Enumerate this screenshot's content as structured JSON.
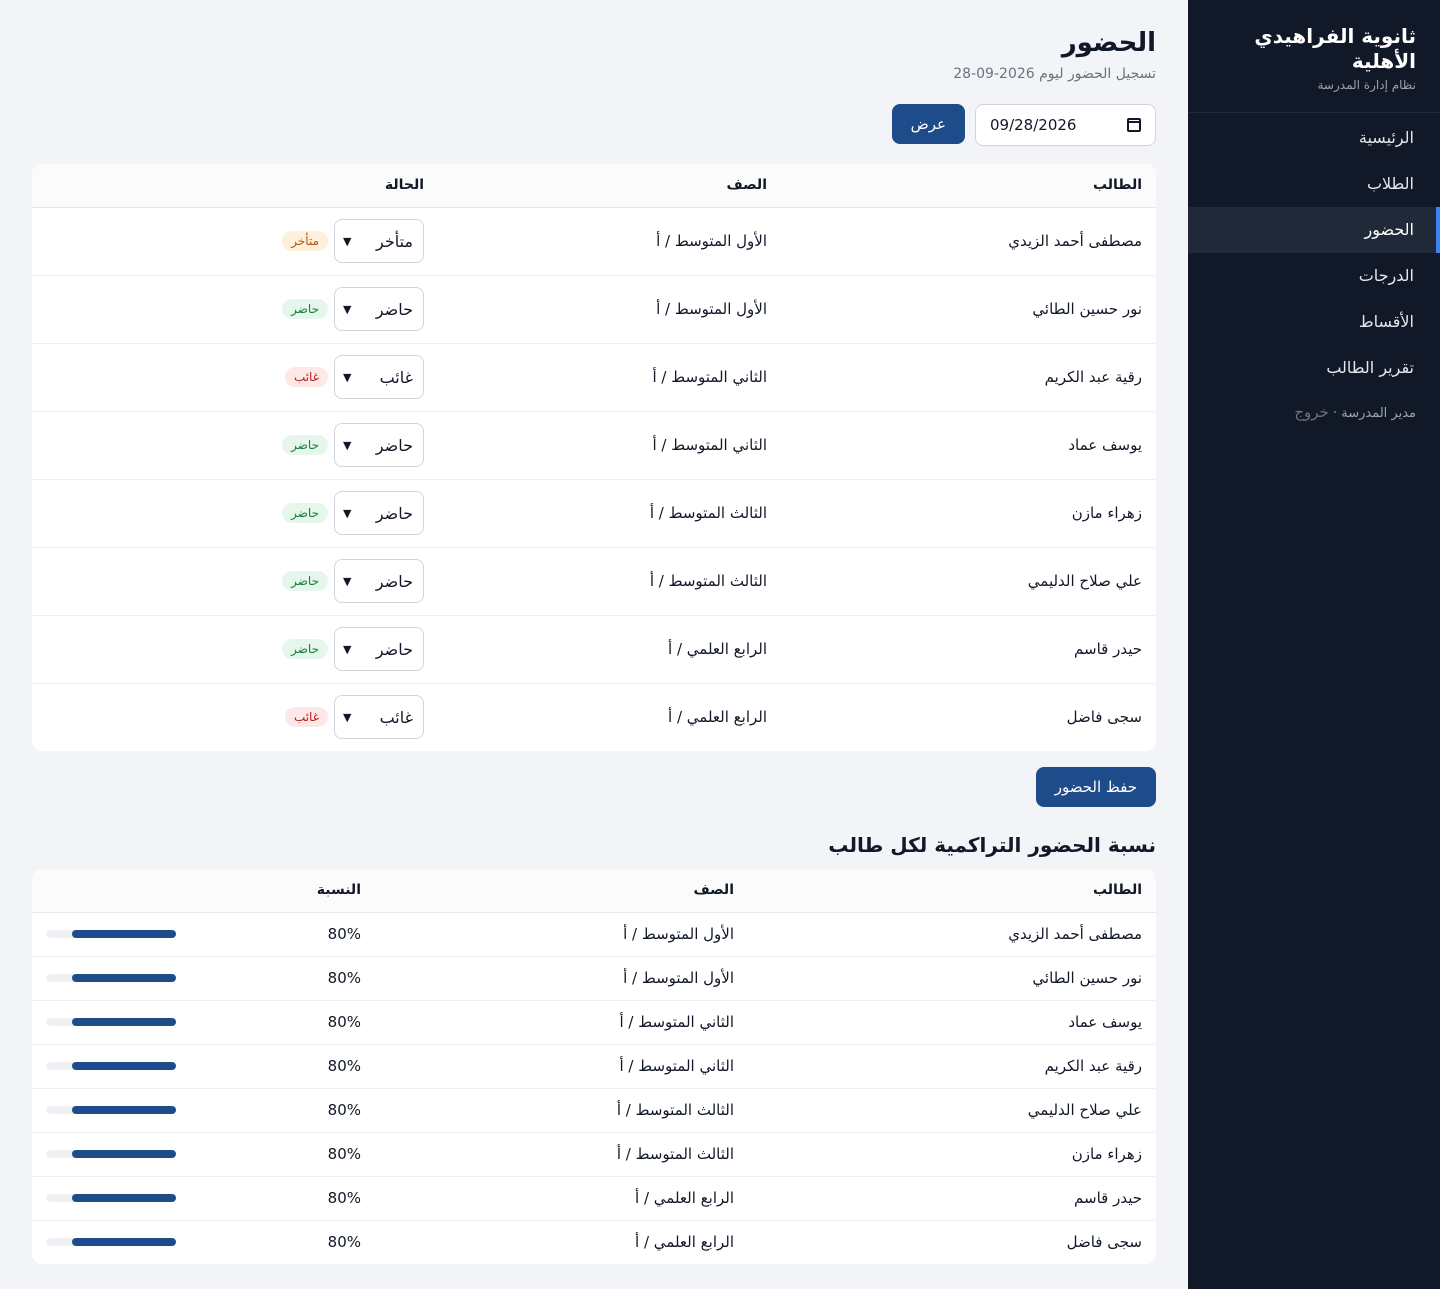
{
  "sidebar": {
    "title": "ثانوية الفراهيدي الأهلية",
    "subtitle": "نظام إدارة المدرسة",
    "items": [
      {
        "label": "الرئيسية",
        "active": false
      },
      {
        "label": "الطلاب",
        "active": false
      },
      {
        "label": "الحضور",
        "active": true
      },
      {
        "label": "الدرجات",
        "active": false
      },
      {
        "label": "الأقساط",
        "active": false
      },
      {
        "label": "تقرير الطالب",
        "active": false
      }
    ],
    "user": "مدير المدرسة",
    "separator": "·",
    "logout": "خروج"
  },
  "header": {
    "title": "الحضور",
    "subtitle": "تسجيل الحضور ليوم 2026-09-28"
  },
  "filters": {
    "date_value": "09/28/2026",
    "show_label": "عرض"
  },
  "attendance": {
    "columns": [
      "الطالب",
      "الصف",
      "الحالة"
    ],
    "rows": [
      {
        "student": "مصطفى أحمد الزيدي",
        "class": "الأول المتوسط / أ",
        "status": "متأخر",
        "badge": "متأخر",
        "kind": "late"
      },
      {
        "student": "نور حسين الطائي",
        "class": "الأول المتوسط / أ",
        "status": "حاضر",
        "badge": "حاضر",
        "kind": "present"
      },
      {
        "student": "رقية عبد الكريم",
        "class": "الثاني المتوسط / أ",
        "status": "غائب",
        "badge": "غائب",
        "kind": "absent"
      },
      {
        "student": "يوسف عماد",
        "class": "الثاني المتوسط / أ",
        "status": "حاضر",
        "badge": "حاضر",
        "kind": "present"
      },
      {
        "student": "زهراء مازن",
        "class": "الثالث المتوسط / أ",
        "status": "حاضر",
        "badge": "حاضر",
        "kind": "present"
      },
      {
        "student": "علي صلاح الدليمي",
        "class": "الثالث المتوسط / أ",
        "status": "حاضر",
        "badge": "حاضر",
        "kind": "present"
      },
      {
        "student": "حيدر قاسم",
        "class": "الرابع العلمي / أ",
        "status": "حاضر",
        "badge": "حاضر",
        "kind": "present"
      },
      {
        "student": "سجى فاضل",
        "class": "الرابع العلمي / أ",
        "status": "غائب",
        "badge": "غائب",
        "kind": "absent"
      }
    ],
    "save_label": "حفظ الحضور"
  },
  "cumulative": {
    "title": "نسبة الحضور التراكمية لكل طالب",
    "columns": [
      "الطالب",
      "الصف",
      "النسبة"
    ],
    "rows": [
      {
        "student": "مصطفى أحمد الزيدي",
        "class": "الأول المتوسط / أ",
        "percent_label": "80%",
        "percent": 80
      },
      {
        "student": "نور حسين الطائي",
        "class": "الأول المتوسط / أ",
        "percent_label": "80%",
        "percent": 80
      },
      {
        "student": "يوسف عماد",
        "class": "الثاني المتوسط / أ",
        "percent_label": "80%",
        "percent": 80
      },
      {
        "student": "رقية عبد الكريم",
        "class": "الثاني المتوسط / أ",
        "percent_label": "80%",
        "percent": 80
      },
      {
        "student": "علي صلاح الدليمي",
        "class": "الثالث المتوسط / أ",
        "percent_label": "80%",
        "percent": 80
      },
      {
        "student": "زهراء مازن",
        "class": "الثالث المتوسط / أ",
        "percent_label": "80%",
        "percent": 80
      },
      {
        "student": "حيدر قاسم",
        "class": "الرابع العلمي / أ",
        "percent_label": "80%",
        "percent": 80
      },
      {
        "student": "سجى فاضل",
        "class": "الرابع العلمي / أ",
        "percent_label": "80%",
        "percent": 80
      }
    ]
  },
  "colors": {
    "sidebar_bg": "#111827",
    "accent": "#1e4b8a",
    "present": "#15803d",
    "absent": "#b91c1c",
    "late": "#b45309"
  }
}
